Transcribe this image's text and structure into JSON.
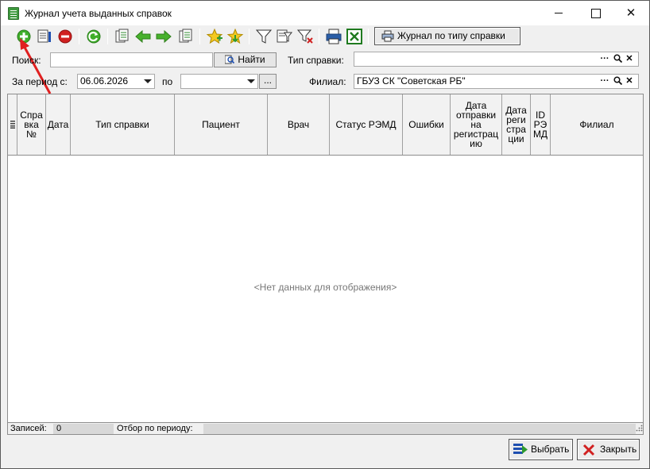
{
  "window": {
    "title": "Журнал учета выданных справок"
  },
  "toolbar": {
    "icons": [
      "add-icon",
      "edit-icon",
      "delete-icon",
      "refresh-icon",
      "copy-icon",
      "arrow-left-icon",
      "arrow-right-icon",
      "copy2-icon",
      "star-add-icon",
      "star-down-icon",
      "filter-icon",
      "filter-edit-icon",
      "filter-clear-icon",
      "print-icon",
      "excel-icon"
    ],
    "journal_button_label": "Журнал по типу справки"
  },
  "filters": {
    "search_label": "Поиск:",
    "search_value": "",
    "find_button": "Найти",
    "cert_type_label": "Тип справки:",
    "cert_type_value": "",
    "period_label": "За период с:",
    "period_from": "06.06.2026",
    "period_to_label": "по",
    "period_to": "",
    "branch_label": "Филиал:",
    "branch_value": "ГБУЗ СК \"Советская РБ\"",
    "ellipsis": "..."
  },
  "grid": {
    "columns": [
      "Справка №",
      "Дата",
      "Тип справки",
      "Пациент",
      "Врач",
      "Статус РЭМД",
      "Ошибки",
      "Дата отправки на регистрацию",
      "Дата регистрации",
      "ID РЭ МД",
      "Филиал"
    ],
    "column_display": [
      "Спра\nвка\n№",
      "Дата",
      "Тип справки",
      "Пациент",
      "Врач",
      "Статус РЭМД",
      "Ошибки",
      "Дата\nотправки\nна\nрегистрац\nию",
      "Дата\nреги\nстра\nции",
      "ID\nРЭ\nМД",
      "Филиал"
    ],
    "empty_text": "<Нет данных для отображения>"
  },
  "status": {
    "records_label": "Записей:",
    "records_count": "0",
    "period_label": "Отбор по периоду:"
  },
  "buttons": {
    "select": "Выбрать",
    "close": "Закрыть"
  },
  "colors": {
    "accent_green": "#3fae2a",
    "delete_red": "#d12020",
    "pointer_red": "#e02020"
  }
}
